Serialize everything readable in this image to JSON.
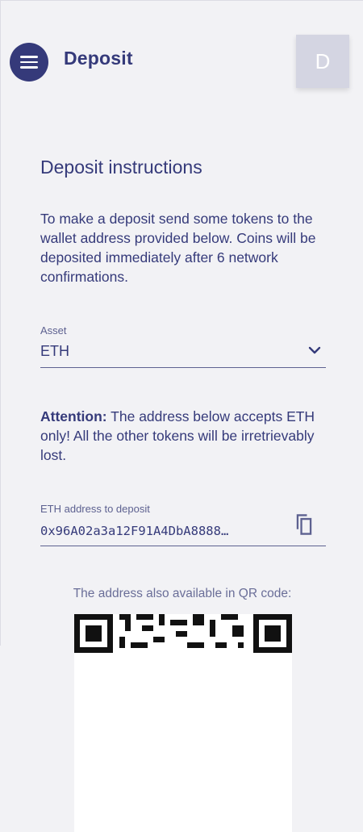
{
  "header": {
    "menu_icon": "hamburger-menu-icon",
    "title": "Deposit",
    "avatar_letter": "D"
  },
  "main": {
    "section_title": "Deposit instructions",
    "instructions": "To make a deposit send some tokens to the wallet address provided below. Coins will be deposited immediately after 6 network confirmations.",
    "asset": {
      "label": "Asset",
      "value": "ETH",
      "dropdown_icon": "chevron-down-icon"
    },
    "attention": {
      "prefix": "Attention:",
      "text": " The address below accepts ETH only! All the other tokens will be irretrievably lost."
    },
    "address": {
      "label": "ETH address to deposit",
      "value": "0x96A02a3a12F91A4DbA8888…",
      "copy_icon": "copy-icon"
    },
    "qr_caption": "The address also available in QR code:"
  },
  "colors": {
    "primary": "#353a7a",
    "background": "#f2f2f5",
    "avatar_bg": "#d4d5e2",
    "secondary_text": "#5d6190"
  }
}
